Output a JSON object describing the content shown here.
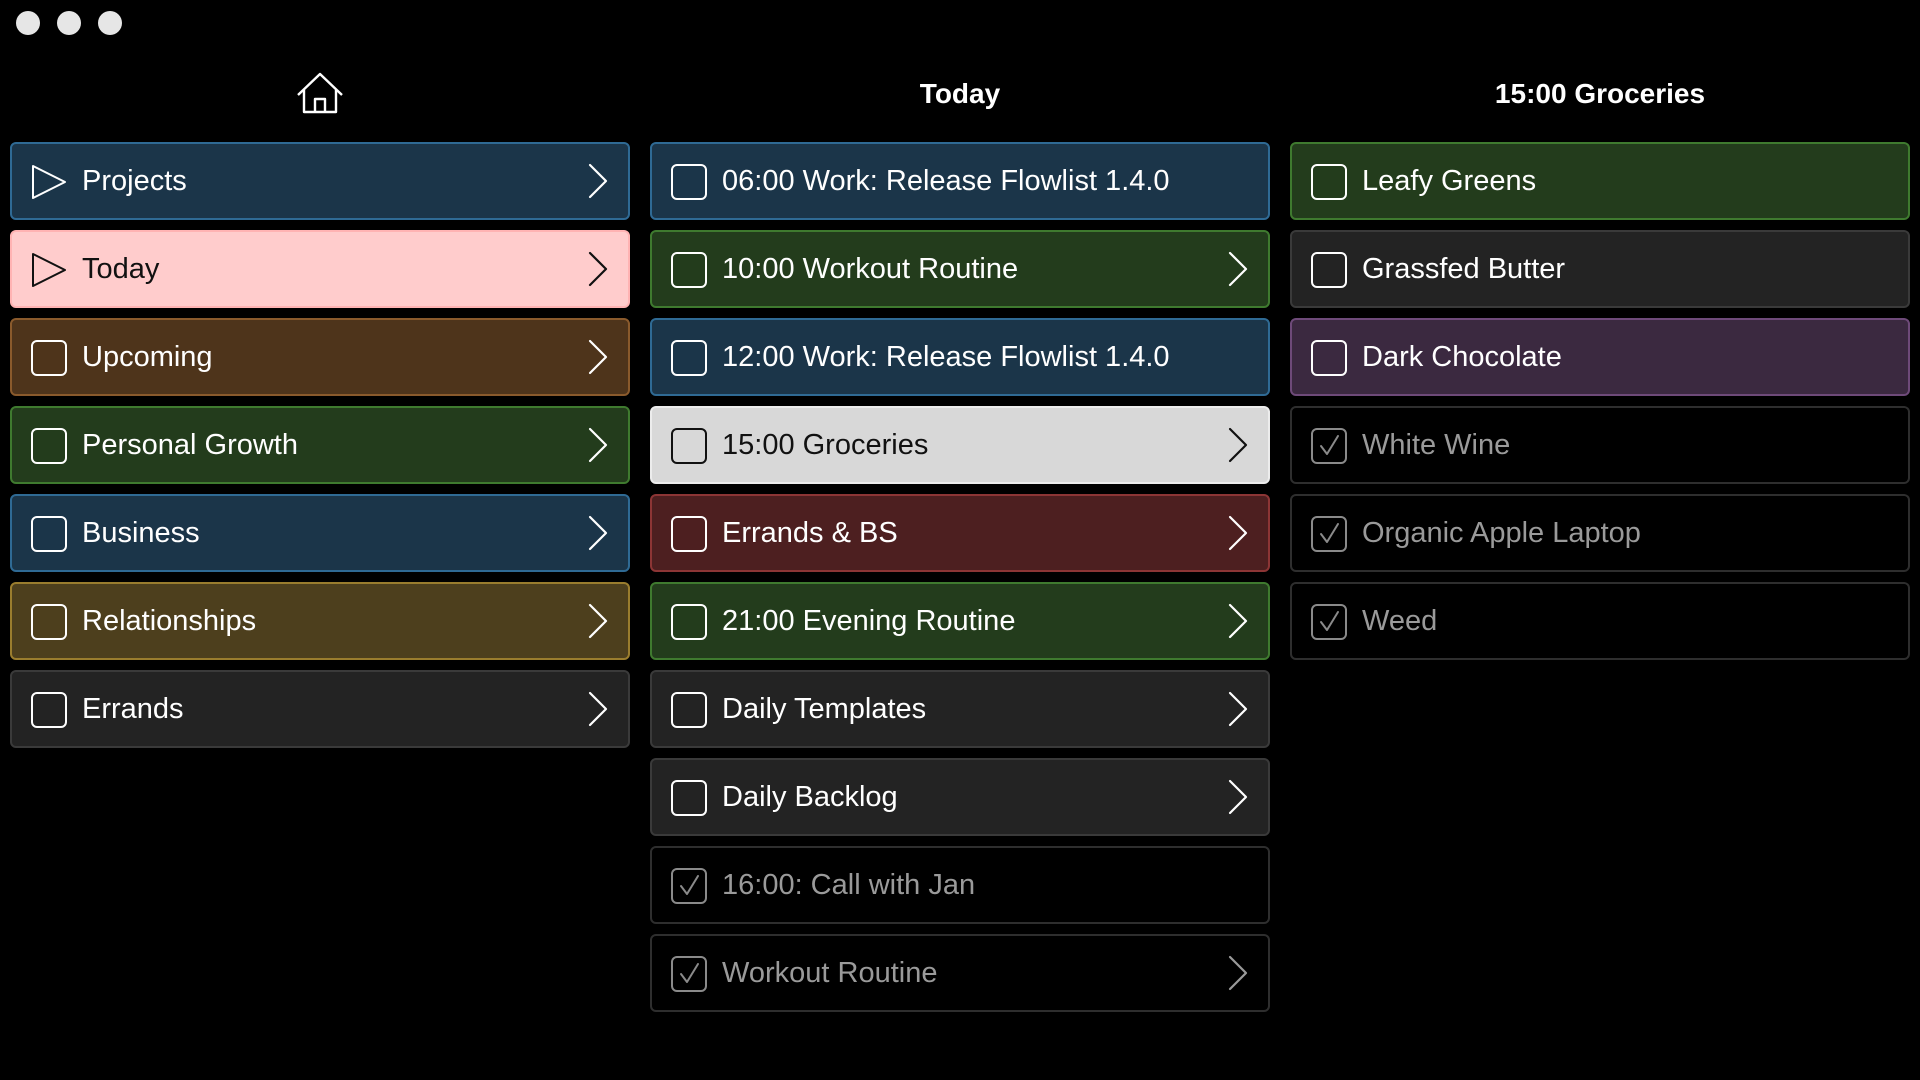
{
  "window": {
    "traffic_lights": [
      "close",
      "minimize",
      "zoom"
    ]
  },
  "columns": {
    "left": {
      "header_icon": "home-icon",
      "items": [
        {
          "label": "Projects",
          "lead": "play",
          "color": "blue",
          "chevron": true,
          "done": false
        },
        {
          "label": "Today",
          "lead": "play",
          "color": "pink",
          "chevron": true,
          "done": false
        },
        {
          "label": "Upcoming",
          "lead": "checkbox",
          "color": "brown",
          "chevron": true,
          "done": false
        },
        {
          "label": "Personal Growth",
          "lead": "checkbox",
          "color": "green",
          "chevron": true,
          "done": false
        },
        {
          "label": "Business",
          "lead": "checkbox",
          "color": "blue",
          "chevron": true,
          "done": false
        },
        {
          "label": "Relationships",
          "lead": "checkbox",
          "color": "olive",
          "chevron": true,
          "done": false
        },
        {
          "label": "Errands",
          "lead": "checkbox",
          "color": "dark",
          "chevron": true,
          "done": false
        }
      ]
    },
    "middle": {
      "title": "Today",
      "items": [
        {
          "label": "06:00 Work: Release Flowlist 1.4.0",
          "lead": "checkbox",
          "color": "blue",
          "chevron": false,
          "done": false
        },
        {
          "label": "10:00 Workout Routine",
          "lead": "checkbox",
          "color": "green",
          "chevron": true,
          "done": false
        },
        {
          "label": "12:00 Work: Release Flowlist 1.4.0",
          "lead": "checkbox",
          "color": "blue",
          "chevron": false,
          "done": false
        },
        {
          "label": "15:00 Groceries",
          "lead": "checkbox",
          "color": "light",
          "chevron": true,
          "done": false
        },
        {
          "label": "Errands & BS",
          "lead": "checkbox",
          "color": "red",
          "chevron": true,
          "done": false
        },
        {
          "label": "21:00 Evening Routine",
          "lead": "checkbox",
          "color": "green",
          "chevron": true,
          "done": false
        },
        {
          "label": "Daily Templates",
          "lead": "checkbox",
          "color": "dark",
          "chevron": true,
          "done": false
        },
        {
          "label": "Daily Backlog",
          "lead": "checkbox",
          "color": "dark",
          "chevron": true,
          "done": false
        },
        {
          "label": "16:00: Call with Jan",
          "lead": "checkbox",
          "color": "black",
          "chevron": false,
          "done": true
        },
        {
          "label": "Workout Routine",
          "lead": "checkbox",
          "color": "black",
          "chevron": true,
          "done": true
        }
      ]
    },
    "right": {
      "title": "15:00 Groceries",
      "items": [
        {
          "label": "Leafy Greens",
          "lead": "checkbox",
          "color": "green",
          "chevron": false,
          "done": false
        },
        {
          "label": "Grassfed Butter",
          "lead": "checkbox",
          "color": "dark",
          "chevron": false,
          "done": false
        },
        {
          "label": "Dark Chocolate",
          "lead": "checkbox",
          "color": "purple",
          "chevron": false,
          "done": false
        },
        {
          "label": "White Wine",
          "lead": "checkbox",
          "color": "black",
          "chevron": false,
          "done": true
        },
        {
          "label": "Organic Apple Laptop",
          "lead": "checkbox",
          "color": "black",
          "chevron": false,
          "done": true
        },
        {
          "label": "Weed",
          "lead": "checkbox",
          "color": "black",
          "chevron": false,
          "done": true
        }
      ]
    }
  },
  "colors": {
    "blue": "#1b3549",
    "pink": "#ffcccc",
    "brown": "#4e341b",
    "green": "#233c1c",
    "olive": "#4d3f1d",
    "dark": "#232323",
    "light": "#d8d8d8",
    "red": "#4d1f20",
    "purple": "#3b2940",
    "black": "#000000"
  }
}
